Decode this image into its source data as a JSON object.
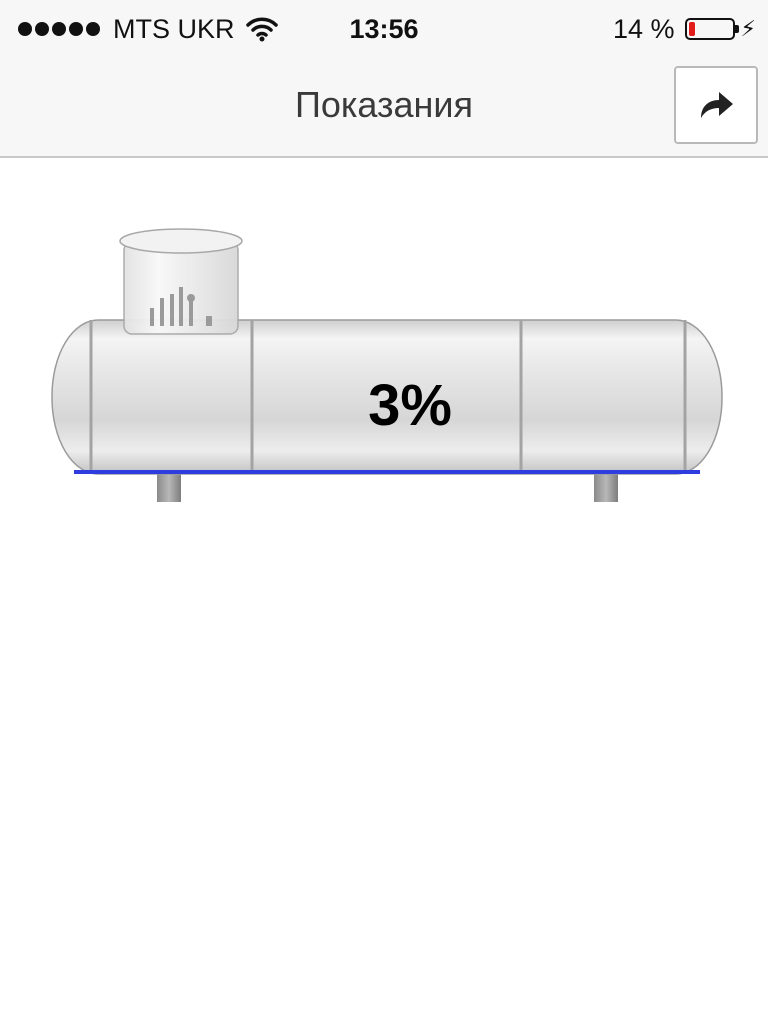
{
  "status_bar": {
    "carrier": "MTS UKR",
    "time": "13:56",
    "battery_percent_text": "14 %",
    "battery_level": 0.14,
    "signal_icon": "signal-dots-icon",
    "wifi_icon": "wifi-icon",
    "charging_icon": "bolt-icon"
  },
  "nav": {
    "title": "Показания",
    "share_icon": "share-arrow-icon"
  },
  "tank": {
    "fill_level_text": "3%",
    "fill_level": 0.03,
    "level_line_color": "#2f3de0"
  }
}
